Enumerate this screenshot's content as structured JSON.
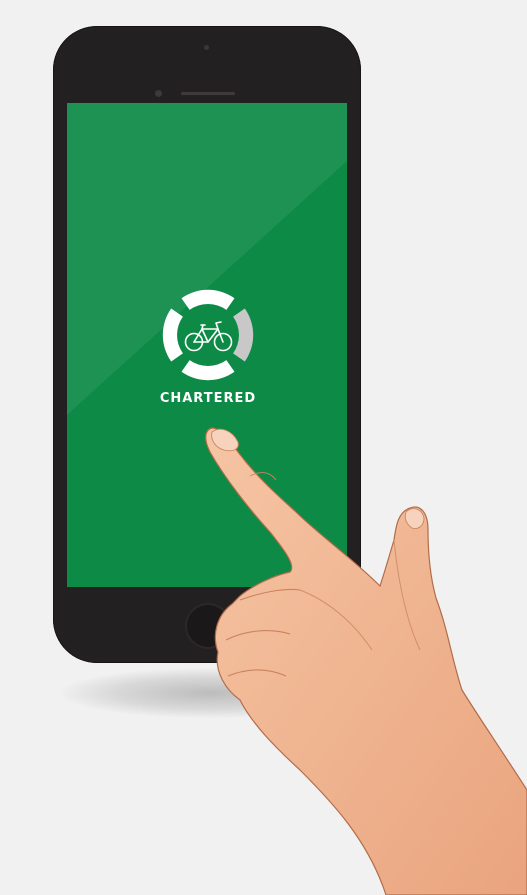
{
  "app": {
    "brand_name": "CHARTERED",
    "logo_icon": "bicycle-icon"
  },
  "colors": {
    "background": "#f1f1f1",
    "phone_body": "#232021",
    "screen": "#0c8a46",
    "logo_ring_white": "#ffffff",
    "logo_ring_gray": "#c8c8c8"
  }
}
